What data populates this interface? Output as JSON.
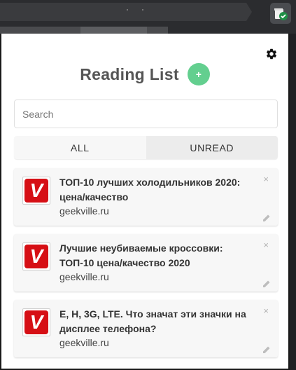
{
  "popup": {
    "title": "Reading List",
    "add_label": "+",
    "search": {
      "placeholder": "Search",
      "value": ""
    },
    "tabs": [
      {
        "label": "ALL"
      },
      {
        "label": "UNREAD"
      }
    ],
    "items": [
      {
        "title": "ТОП-10 лучших холодильников 2020: цена/качество",
        "domain": "geekville.ru",
        "favicon_letter": "V",
        "close": "×"
      },
      {
        "title": "Лучшие неубиваемые кроссовки: ТОП-10 цена/качество 2020",
        "domain": "geekville.ru",
        "favicon_letter": "V",
        "close": "×"
      },
      {
        "title": "E, H, 3G, LTE. Что значат эти значки на дисплее телефона?",
        "domain": "geekville.ru",
        "favicon_letter": "V",
        "close": "×"
      }
    ]
  },
  "colors": {
    "accent_green": "#63cf8f",
    "favicon_red": "#d60f15"
  },
  "icons": {
    "extension": "reading-list-check-icon",
    "settings": "gear-icon",
    "edit": "pencil-icon"
  }
}
